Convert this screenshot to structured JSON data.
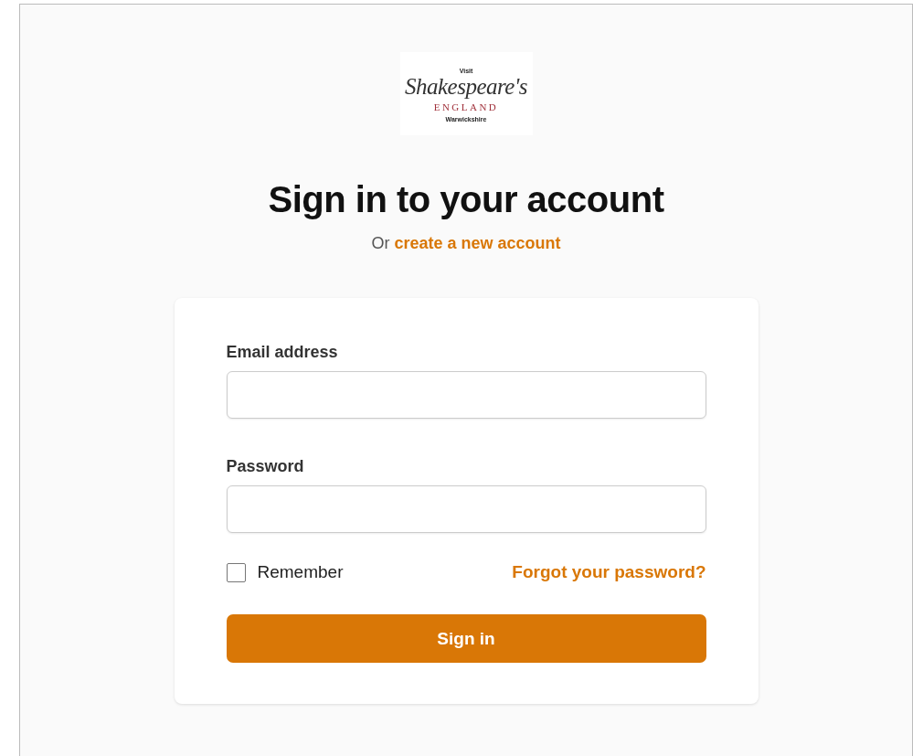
{
  "logo": {
    "visit": "Visit",
    "name": "Shakespeare's",
    "country": "ENGLAND",
    "region": "Warwickshire"
  },
  "heading": "Sign in to your account",
  "subtitle": {
    "prefix": "Or",
    "link": "create a new account"
  },
  "form": {
    "fields": [
      {
        "label": "Email address"
      },
      {
        "label": "Password"
      }
    ],
    "remember": {
      "label": "Remember",
      "checked": false
    },
    "forgot_link": "Forgot your password?",
    "submit": "Sign in"
  }
}
